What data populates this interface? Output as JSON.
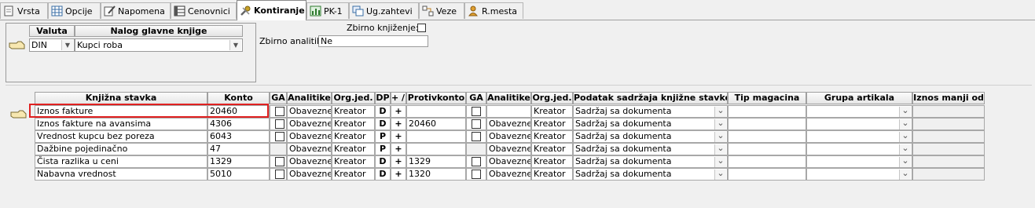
{
  "tabs": [
    {
      "label": "Vrsta",
      "icon": "document-icon",
      "active": false
    },
    {
      "label": "Opcije",
      "icon": "grid-icon",
      "active": false
    },
    {
      "label": "Napomena",
      "icon": "note-pencil-icon",
      "active": false
    },
    {
      "label": "Cenovnici",
      "icon": "table-icon",
      "active": false
    },
    {
      "label": "Kontiranje",
      "icon": "tools-icon",
      "active": true
    },
    {
      "label": "PK-1",
      "icon": "chart-icon",
      "active": false
    },
    {
      "label": "Ug.zahtevi",
      "icon": "windows-icon",
      "active": false
    },
    {
      "label": "Veze",
      "icon": "links-icon",
      "active": false
    },
    {
      "label": "R.mesta",
      "icon": "person-icon",
      "active": false
    }
  ],
  "nalog": {
    "col_valuta": "Valuta",
    "col_nalog": "Nalog glavne knjige",
    "valuta_value": "DIN",
    "nalog_value": "Kupci roba"
  },
  "options": {
    "zbirno_knjizenje_label": "Zbirno knjiženje:",
    "zbirno_knjizenje_checked": false,
    "zbirno_analitike_label": "Zbirno analitike:",
    "zbirno_analitike_value": "Ne"
  },
  "grid": {
    "headers": [
      "Knjižna stavka",
      "Konto",
      "GA",
      "Analitike",
      "Org.jed.",
      "DP",
      "+ / -",
      "Protivkonto",
      "GA",
      "Analitike",
      "Org.jed.",
      "Podatak sadržaja knjižne stavke",
      "Tip magacina",
      "Grupa artikala",
      "Iznos manji od"
    ],
    "rows": [
      {
        "stavka": "Iznos fakture",
        "konto": "20460",
        "ga": true,
        "analitike": "Obavezne",
        "orgjed": "Kreator",
        "dp": "D",
        "pm": "+",
        "protivkonto": "",
        "ga2": true,
        "analitike2": "",
        "orgjed2": "Kreator",
        "podatak": "Sadržaj sa dokumenta",
        "tip": "",
        "grupa": "",
        "iznos": ""
      },
      {
        "stavka": "Iznos fakture na avansima",
        "konto": "4306",
        "ga": true,
        "analitike": "Obavezne",
        "orgjed": "Kreator",
        "dp": "D",
        "pm": "+",
        "protivkonto": "20460",
        "ga2": true,
        "analitike2": "Obavezne",
        "orgjed2": "Kreator",
        "podatak": "Sadržaj sa dokumenta",
        "tip": "",
        "grupa": "",
        "iznos": ""
      },
      {
        "stavka": "Vrednost kupcu bez poreza",
        "konto": "6043",
        "ga": true,
        "analitike": "Obavezne",
        "orgjed": "Kreator",
        "dp": "P",
        "pm": "+",
        "protivkonto": "",
        "ga2": true,
        "analitike2": "Obavezne",
        "orgjed2": "Kreator",
        "podatak": "Sadržaj sa dokumenta",
        "tip": "",
        "grupa": "",
        "iznos": ""
      },
      {
        "stavka": "Dažbine pojedinačno",
        "konto": "47",
        "ga": false,
        "analitike": "Obavezne",
        "orgjed": "Kreator",
        "dp": "P",
        "pm": "+",
        "protivkonto": "",
        "ga2": false,
        "analitike2": "Obavezne",
        "orgjed2": "Kreator",
        "podatak": "Sadržaj sa dokumenta",
        "tip": "",
        "grupa": "",
        "iznos": ""
      },
      {
        "stavka": "Čista razlika u ceni",
        "konto": "1329",
        "ga": true,
        "analitike": "Obavezne",
        "orgjed": "Kreator",
        "dp": "D",
        "pm": "+",
        "protivkonto": "1329",
        "ga2": true,
        "analitike2": "Obavezne",
        "orgjed2": "Kreator",
        "podatak": "Sadržaj sa dokumenta",
        "tip": "",
        "grupa": "",
        "iznos": ""
      },
      {
        "stavka": "Nabavna vrednost",
        "konto": "5010",
        "ga": true,
        "analitike": "Obavezne",
        "orgjed": "Kreator",
        "dp": "D",
        "pm": "+",
        "protivkonto": "1320",
        "ga2": true,
        "analitike2": "Obavezne",
        "orgjed2": "Kreator",
        "podatak": "Sadržaj sa dokumenta",
        "tip": "",
        "grupa": "",
        "iznos": ""
      }
    ]
  },
  "colors": {
    "highlight": "#e02020",
    "active_tab_bg": "#ffffff",
    "panel_bg": "#f0f0f0"
  }
}
